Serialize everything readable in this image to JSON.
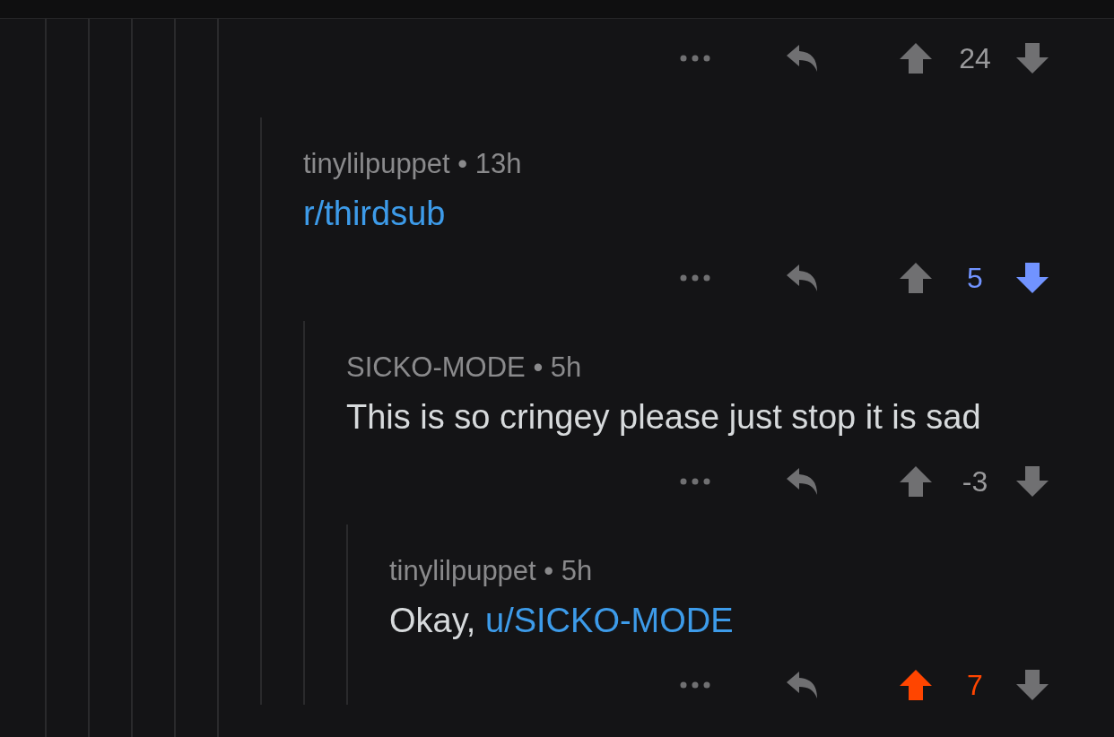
{
  "top_actions": {
    "score": "24",
    "upvoted": false,
    "downvoted": false
  },
  "comments": [
    {
      "byline": "tinylilpuppet • 13h",
      "body": [
        {
          "kind": "link",
          "text": "r/thirdsub"
        }
      ],
      "score": "5",
      "upvoted": false,
      "downvoted": true,
      "children": [
        {
          "byline": "SICKO-MODE • 5h",
          "body": [
            {
              "kind": "text",
              "text": "This is so cringey please just stop it is sad"
            }
          ],
          "score": "-3",
          "upvoted": false,
          "downvoted": false,
          "children": [
            {
              "byline": "tinylilpuppet • 5h",
              "body": [
                {
                  "kind": "text",
                  "text": "Okay, "
                },
                {
                  "kind": "link",
                  "text": "u/SICKO-MODE"
                }
              ],
              "score": "7",
              "upvoted": true,
              "downvoted": false
            }
          ]
        }
      ]
    }
  ]
}
